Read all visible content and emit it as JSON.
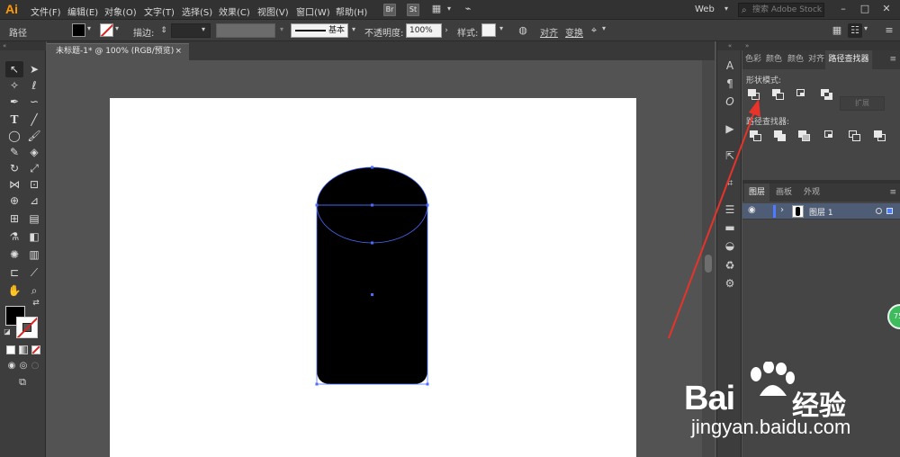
{
  "app": {
    "logo": "Ai",
    "menus": [
      "文件(F)",
      "编辑(E)",
      "对象(O)",
      "文字(T)",
      "选择(S)",
      "效果(C)",
      "视图(V)",
      "窗口(W)",
      "帮助(H)"
    ],
    "bridge": "Br",
    "stock": "St",
    "workspace": "Web",
    "search_placeholder": "搜索 Adobe Stock"
  },
  "control": {
    "object_type": "路径",
    "stroke_label": "描边:",
    "stroke_style": "基本",
    "opacity_label": "不透明度:",
    "opacity_value": "100%",
    "style_label": "样式:",
    "align_label": "对齐",
    "transform_label": "变换"
  },
  "document": {
    "tab_title": "未标题-1* @ 100% (RGB/预览)",
    "close": "×"
  },
  "pathfinder": {
    "tabs": [
      "色彩",
      "颜色",
      "颜色",
      "对齐",
      "路径查找器"
    ],
    "active_tab": "路径查找器",
    "shape_modes_label": "形状模式:",
    "pathfinders_label": "路径查找器:",
    "expand_label": "扩展"
  },
  "layers": {
    "tabs": [
      "图层",
      "画板",
      "外观"
    ],
    "layer_name": "图层 1"
  },
  "badge": "75",
  "watermark": {
    "brand_a": "Bai",
    "brand_b": "经验",
    "url": "jingyan.baidu.com"
  },
  "colors": {
    "accent": "#ff9a00",
    "selection": "#4f7cff",
    "layer_row": "#4e5c75",
    "arrow": "#e8332a"
  }
}
